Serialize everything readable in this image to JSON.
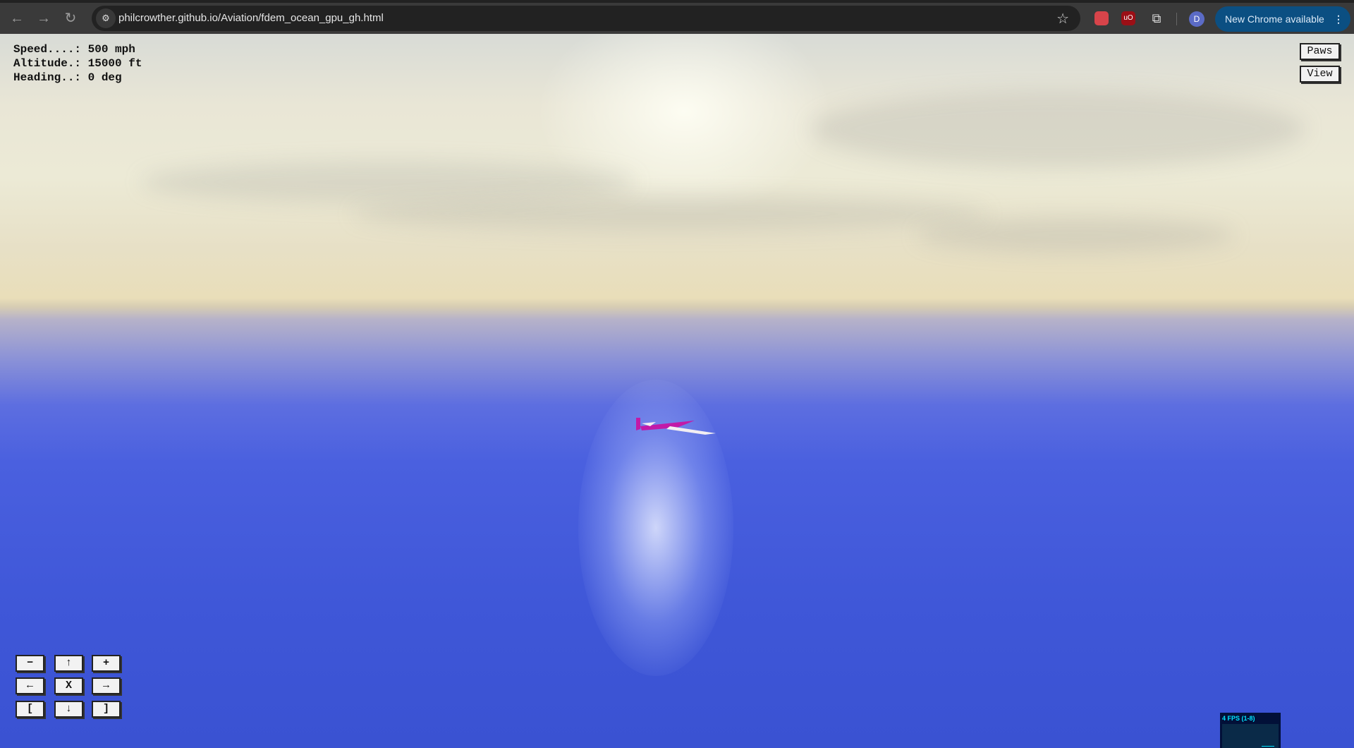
{
  "browser": {
    "url": "philcrowther.github.io/Aviation/fdem_ocean_gpu_gh.html",
    "update_label": "New Chrome available",
    "avatar_letter": "D",
    "ext1": "",
    "ext2": "uO"
  },
  "hud": {
    "speed": "Speed....: 500 mph",
    "altitude": "Altitude.: 15000 ft",
    "heading": "Heading..: 0 deg"
  },
  "buttons": {
    "paws": "Paws",
    "view": "View"
  },
  "pad": [
    "−",
    "↑",
    "+",
    "←",
    "X",
    "→",
    "[",
    "↓",
    "]"
  ],
  "fps": {
    "label": "4 FPS (1-8)"
  },
  "colors": {
    "plane": "#c21aa8",
    "ocean": "#3f57d8"
  }
}
